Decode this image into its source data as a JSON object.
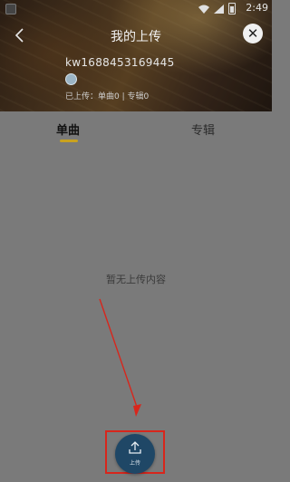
{
  "status_bar": {
    "time": "2:49"
  },
  "header": {
    "title": "我的上传",
    "username": "kw1688453169445",
    "stats": "已上传：单曲0 | 专辑0"
  },
  "tabs": [
    {
      "label": "单曲",
      "active": true
    },
    {
      "label": "专辑",
      "active": false
    }
  ],
  "content": {
    "empty_message": "暂无上传内容"
  },
  "upload_button": {
    "label": "上传"
  },
  "colors": {
    "active_tab_underline": "#c9a21f",
    "upload_button": "#1f4766",
    "annotation_red": "#d8261c"
  }
}
